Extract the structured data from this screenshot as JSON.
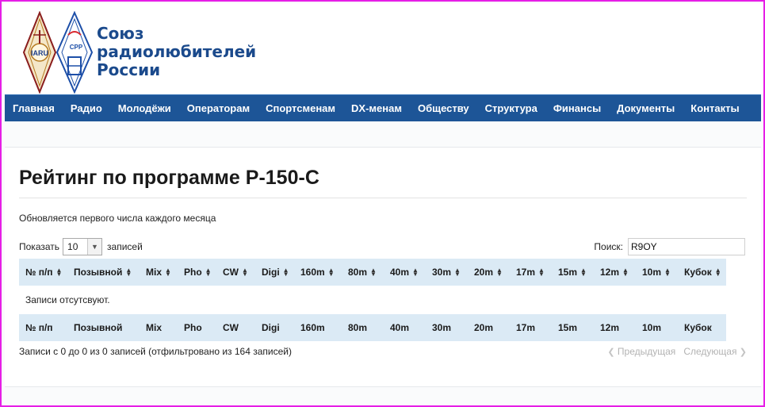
{
  "brand": {
    "line1": "Союз",
    "line2": "радиолюбителей",
    "line3": "России",
    "emblem_left_text": "IARU",
    "emblem_right_text": "СРР"
  },
  "nav": [
    {
      "label": "Главная"
    },
    {
      "label": "Радио"
    },
    {
      "label": "Молодёжи"
    },
    {
      "label": "Операторам"
    },
    {
      "label": "Спортсменам"
    },
    {
      "label": "DX-менам"
    },
    {
      "label": "Обществу"
    },
    {
      "label": "Структура"
    },
    {
      "label": "Финансы"
    },
    {
      "label": "Документы"
    },
    {
      "label": "Контакты"
    }
  ],
  "page": {
    "title": "Рейтинг по программе Р-150-С",
    "subtitle": "Обновляется первого числа каждого месяца"
  },
  "length": {
    "prefix": "Показать",
    "value": "10",
    "suffix": "записей"
  },
  "search": {
    "label": "Поиск:",
    "value": "R9OY"
  },
  "table": {
    "columns": [
      "№ п/п",
      "Позывной",
      "Mix",
      "Pho",
      "CW",
      "Digi",
      "160m",
      "80m",
      "40m",
      "30m",
      "20m",
      "17m",
      "15m",
      "12m",
      "10m",
      "Кубок"
    ],
    "empty_message": "Записи отсутсвуют."
  },
  "info": "Записи с 0 до 0 из 0 записей (отфильтровано из 164 записей)",
  "pager": {
    "prev": "Предыдущая",
    "next": "Следующая"
  },
  "colors": {
    "nav_bg": "#1d5597",
    "brand_text": "#1b4a8c",
    "table_header_bg": "#dbeaf5",
    "frame_border": "#e61ee6"
  }
}
